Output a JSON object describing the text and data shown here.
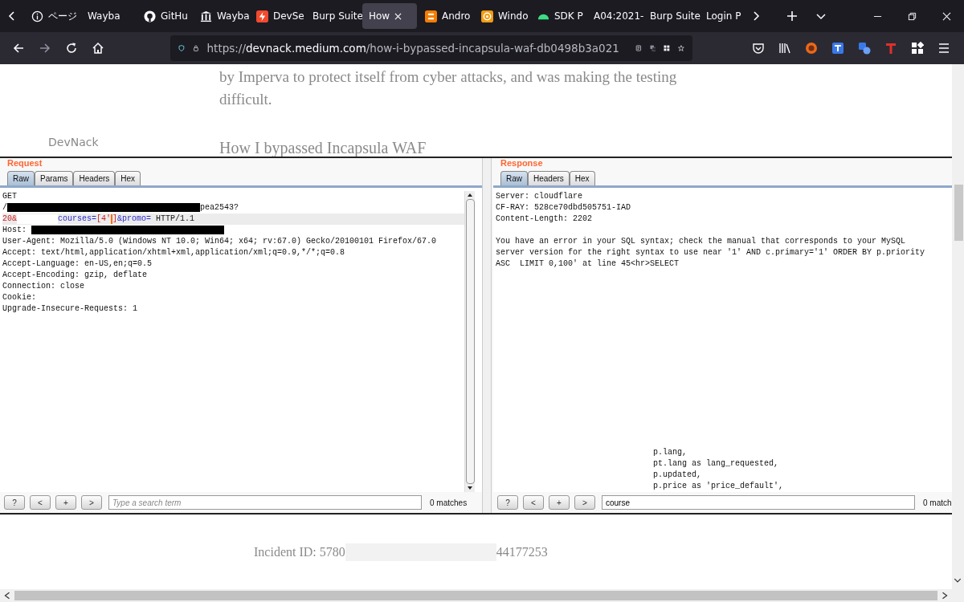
{
  "browser": {
    "tabs": [
      {
        "label": "ページ",
        "selected": false
      },
      {
        "label": "Wayba",
        "selected": false
      },
      {
        "label": "GitHu",
        "selected": false
      },
      {
        "label": "Wayba",
        "selected": false
      },
      {
        "label": "DevSe",
        "selected": false
      },
      {
        "label": "Burp Suite",
        "selected": false
      },
      {
        "label": "How",
        "selected": true
      },
      {
        "label": "Andro",
        "selected": false
      },
      {
        "label": "Windo",
        "selected": false
      },
      {
        "label": "SDK P",
        "selected": false
      },
      {
        "label": "A04:2021-",
        "selected": false
      },
      {
        "label": "Burp Suite",
        "selected": false
      },
      {
        "label": "Login P",
        "selected": false
      }
    ],
    "url": {
      "scheme": "https://",
      "host": "devnack.medium.com",
      "path": "/how-i-bypassed-incapsula-waf-db0498b3a021"
    }
  },
  "article": {
    "paragraph_lines": [
      "by Imperva to protect itself from cyber attacks, and was making the testing",
      "difficult."
    ],
    "author": "DevNack",
    "heading": "How I bypassed Incapsula WAF"
  },
  "burp": {
    "request": {
      "title": "Request",
      "tabs": [
        {
          "label": "Raw",
          "selected": true
        },
        {
          "label": "Params",
          "selected": false
        },
        {
          "label": "Headers",
          "selected": false
        },
        {
          "label": "Hex",
          "selected": false
        }
      ],
      "lines": [
        {
          "highlighted": false,
          "segments": [
            {
              "kind": "plain",
              "text": "GET"
            }
          ]
        },
        {
          "highlighted": false,
          "segments": [
            {
              "kind": "plain",
              "text": "/"
            },
            {
              "kind": "redacted"
            },
            {
              "kind": "plain",
              "text": "pea2543?"
            }
          ]
        },
        {
          "highlighted": true,
          "segments": [
            {
              "kind": "value",
              "text": "20&"
            },
            {
              "kind": "blank"
            },
            {
              "kind": "param",
              "text": "courses="
            },
            {
              "kind": "value",
              "text": "[4'"
            },
            {
              "kind": "caret"
            },
            {
              "kind": "value",
              "text": "]"
            },
            {
              "kind": "param",
              "text": "&promo="
            },
            {
              "kind": "plain",
              "text": " HTTP/1.1"
            }
          ]
        },
        {
          "highlighted": false,
          "segments": [
            {
              "kind": "plain",
              "text": "Host: "
            },
            {
              "kind": "redacted"
            }
          ]
        },
        {
          "highlighted": false,
          "segments": [
            {
              "kind": "plain",
              "text": "User-Agent: Mozilla/5.0 (Windows NT 10.0; Win64; x64; rv:67.0) Gecko/20100101 Firefox/67.0"
            }
          ]
        },
        {
          "highlighted": false,
          "segments": [
            {
              "kind": "plain",
              "text": "Accept: text/html,application/xhtml+xml,application/xml;q=0.9,*/*;q=0.8"
            }
          ]
        },
        {
          "highlighted": false,
          "segments": [
            {
              "kind": "plain",
              "text": "Accept-Language: en-US,en;q=0.5"
            }
          ]
        },
        {
          "highlighted": false,
          "segments": [
            {
              "kind": "plain",
              "text": "Accept-Encoding: gzip, deflate"
            }
          ]
        },
        {
          "highlighted": false,
          "segments": [
            {
              "kind": "plain",
              "text": "Connection: close"
            }
          ]
        },
        {
          "highlighted": false,
          "segments": [
            {
              "kind": "plain",
              "text": "Cookie:"
            }
          ]
        },
        {
          "highlighted": false,
          "segments": [
            {
              "kind": "plain",
              "text": "Upgrade-Insecure-Requests: 1"
            }
          ]
        }
      ],
      "search": {
        "buttons": [
          "?",
          "<",
          "+",
          ">"
        ],
        "placeholder": "Type a search term",
        "matches": "0 matches"
      }
    },
    "response": {
      "title": "Response",
      "tabs": [
        {
          "label": "Raw",
          "selected": true
        },
        {
          "label": "Headers",
          "selected": false
        },
        {
          "label": "Hex",
          "selected": false
        }
      ],
      "head_lines": [
        "Server: cloudflare",
        "CF-RAY: 528ce70dbd505751-IAD",
        "Content-Length: 2202"
      ],
      "body_lines": [
        "You have an error in your SQL syntax; check the manual that corresponds to your MySQL",
        "server version for the right syntax to use near '1' AND c.primary='1' ORDER BY p.priority",
        "ASC  LIMIT 0,100' at line 45<hr>SELECT"
      ],
      "sql_lines": [
        "p.lang,",
        "pt.lang as lang_requested,",
        "p.updated,",
        "p.price as 'price_default',"
      ],
      "search": {
        "buttons": [
          "?",
          "<",
          "+",
          ">"
        ],
        "value": "course",
        "matches": "0 match"
      }
    }
  },
  "incident": {
    "prefix": "Incident ID: 5780",
    "suffix": "44177253"
  }
}
